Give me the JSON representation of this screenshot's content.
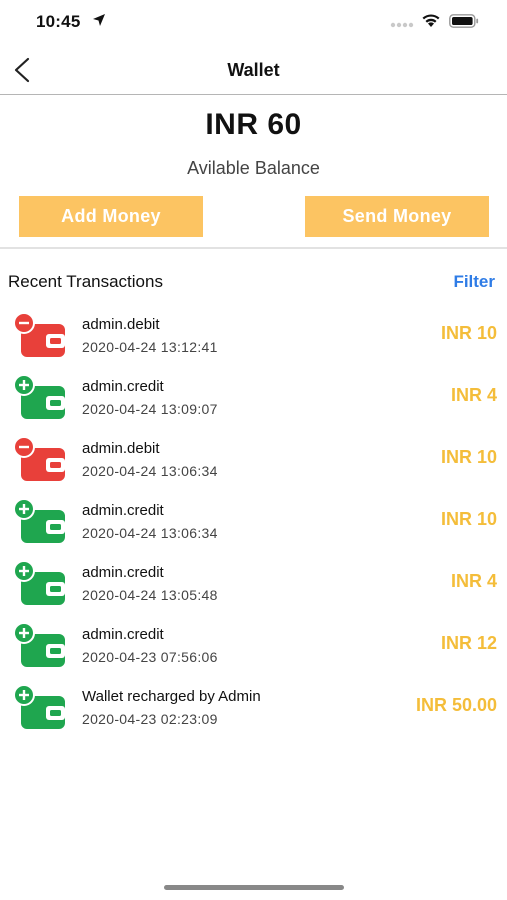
{
  "status_bar": {
    "time": "10:45"
  },
  "nav": {
    "title": "Wallet"
  },
  "balance": {
    "amount": "INR 60",
    "label": "Avilable Balance"
  },
  "actions": {
    "add_money": "Add Money",
    "send_money": "Send Money"
  },
  "transactions_section": {
    "title": "Recent Transactions",
    "filter": "Filter"
  },
  "transactions": [
    {
      "kind": "debit",
      "title": "admin.debit",
      "date": "2020-04-24 13:12:41",
      "amount": "INR 10"
    },
    {
      "kind": "credit",
      "title": "admin.credit",
      "date": "2020-04-24 13:09:07",
      "amount": "INR 4"
    },
    {
      "kind": "debit",
      "title": "admin.debit",
      "date": "2020-04-24 13:06:34",
      "amount": "INR 10"
    },
    {
      "kind": "credit",
      "title": "admin.credit",
      "date": "2020-04-24 13:06:34",
      "amount": "INR 10"
    },
    {
      "kind": "credit",
      "title": "admin.credit",
      "date": "2020-04-24 13:05:48",
      "amount": "INR 4"
    },
    {
      "kind": "credit",
      "title": "admin.credit",
      "date": "2020-04-23 07:56:06",
      "amount": "INR 12"
    },
    {
      "kind": "credit",
      "title": "Wallet recharged by Admin",
      "date": "2020-04-23 02:23:09",
      "amount": "INR 50.00"
    }
  ],
  "icons": {
    "debit": "wallet-minus-icon",
    "credit": "wallet-plus-icon"
  },
  "colors": {
    "action_button": "#fcc462",
    "amount": "#f4bd3a",
    "filter": "#2f7ce6",
    "debit_icon": "#e8403a",
    "credit_icon": "#1fa64f"
  }
}
